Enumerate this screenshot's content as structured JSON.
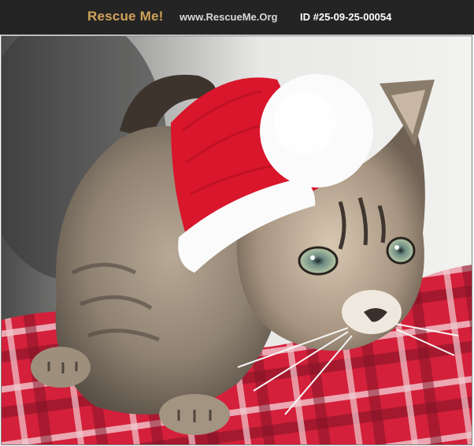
{
  "header": {
    "brand": "Rescue Me!",
    "site_url": "www.RescueMe.Org",
    "pet_id": "ID #25-09-25-00054"
  },
  "colors": {
    "header_bg": "#242424",
    "brand": "#d1a25a",
    "url_text": "#d9d9d9",
    "id_text": "#ffffff",
    "blanket_red": "#d4203a",
    "hat_red": "#d9162b",
    "hat_white": "#fbfbfb",
    "fur_tabby": "#8f8272"
  },
  "photo": {
    "subject": "tabby kitten wearing a Santa hat on a red plaid blanket"
  }
}
